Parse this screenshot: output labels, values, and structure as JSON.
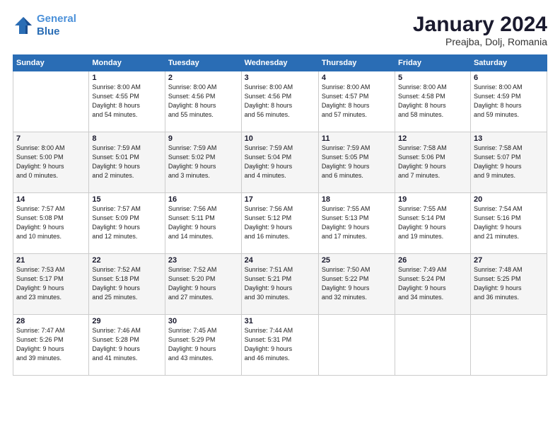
{
  "header": {
    "logo_line1": "General",
    "logo_line2": "Blue",
    "month": "January 2024",
    "location": "Preajba, Dolj, Romania"
  },
  "days_of_week": [
    "Sunday",
    "Monday",
    "Tuesday",
    "Wednesday",
    "Thursday",
    "Friday",
    "Saturday"
  ],
  "weeks": [
    [
      {
        "day": "",
        "info": ""
      },
      {
        "day": "1",
        "info": "Sunrise: 8:00 AM\nSunset: 4:55 PM\nDaylight: 8 hours\nand 54 minutes."
      },
      {
        "day": "2",
        "info": "Sunrise: 8:00 AM\nSunset: 4:56 PM\nDaylight: 8 hours\nand 55 minutes."
      },
      {
        "day": "3",
        "info": "Sunrise: 8:00 AM\nSunset: 4:56 PM\nDaylight: 8 hours\nand 56 minutes."
      },
      {
        "day": "4",
        "info": "Sunrise: 8:00 AM\nSunset: 4:57 PM\nDaylight: 8 hours\nand 57 minutes."
      },
      {
        "day": "5",
        "info": "Sunrise: 8:00 AM\nSunset: 4:58 PM\nDaylight: 8 hours\nand 58 minutes."
      },
      {
        "day": "6",
        "info": "Sunrise: 8:00 AM\nSunset: 4:59 PM\nDaylight: 8 hours\nand 59 minutes."
      }
    ],
    [
      {
        "day": "7",
        "info": "Sunrise: 8:00 AM\nSunset: 5:00 PM\nDaylight: 9 hours\nand 0 minutes."
      },
      {
        "day": "8",
        "info": "Sunrise: 7:59 AM\nSunset: 5:01 PM\nDaylight: 9 hours\nand 2 minutes."
      },
      {
        "day": "9",
        "info": "Sunrise: 7:59 AM\nSunset: 5:02 PM\nDaylight: 9 hours\nand 3 minutes."
      },
      {
        "day": "10",
        "info": "Sunrise: 7:59 AM\nSunset: 5:04 PM\nDaylight: 9 hours\nand 4 minutes."
      },
      {
        "day": "11",
        "info": "Sunrise: 7:59 AM\nSunset: 5:05 PM\nDaylight: 9 hours\nand 6 minutes."
      },
      {
        "day": "12",
        "info": "Sunrise: 7:58 AM\nSunset: 5:06 PM\nDaylight: 9 hours\nand 7 minutes."
      },
      {
        "day": "13",
        "info": "Sunrise: 7:58 AM\nSunset: 5:07 PM\nDaylight: 9 hours\nand 9 minutes."
      }
    ],
    [
      {
        "day": "14",
        "info": "Sunrise: 7:57 AM\nSunset: 5:08 PM\nDaylight: 9 hours\nand 10 minutes."
      },
      {
        "day": "15",
        "info": "Sunrise: 7:57 AM\nSunset: 5:09 PM\nDaylight: 9 hours\nand 12 minutes."
      },
      {
        "day": "16",
        "info": "Sunrise: 7:56 AM\nSunset: 5:11 PM\nDaylight: 9 hours\nand 14 minutes."
      },
      {
        "day": "17",
        "info": "Sunrise: 7:56 AM\nSunset: 5:12 PM\nDaylight: 9 hours\nand 16 minutes."
      },
      {
        "day": "18",
        "info": "Sunrise: 7:55 AM\nSunset: 5:13 PM\nDaylight: 9 hours\nand 17 minutes."
      },
      {
        "day": "19",
        "info": "Sunrise: 7:55 AM\nSunset: 5:14 PM\nDaylight: 9 hours\nand 19 minutes."
      },
      {
        "day": "20",
        "info": "Sunrise: 7:54 AM\nSunset: 5:16 PM\nDaylight: 9 hours\nand 21 minutes."
      }
    ],
    [
      {
        "day": "21",
        "info": "Sunrise: 7:53 AM\nSunset: 5:17 PM\nDaylight: 9 hours\nand 23 minutes."
      },
      {
        "day": "22",
        "info": "Sunrise: 7:52 AM\nSunset: 5:18 PM\nDaylight: 9 hours\nand 25 minutes."
      },
      {
        "day": "23",
        "info": "Sunrise: 7:52 AM\nSunset: 5:20 PM\nDaylight: 9 hours\nand 27 minutes."
      },
      {
        "day": "24",
        "info": "Sunrise: 7:51 AM\nSunset: 5:21 PM\nDaylight: 9 hours\nand 30 minutes."
      },
      {
        "day": "25",
        "info": "Sunrise: 7:50 AM\nSunset: 5:22 PM\nDaylight: 9 hours\nand 32 minutes."
      },
      {
        "day": "26",
        "info": "Sunrise: 7:49 AM\nSunset: 5:24 PM\nDaylight: 9 hours\nand 34 minutes."
      },
      {
        "day": "27",
        "info": "Sunrise: 7:48 AM\nSunset: 5:25 PM\nDaylight: 9 hours\nand 36 minutes."
      }
    ],
    [
      {
        "day": "28",
        "info": "Sunrise: 7:47 AM\nSunset: 5:26 PM\nDaylight: 9 hours\nand 39 minutes."
      },
      {
        "day": "29",
        "info": "Sunrise: 7:46 AM\nSunset: 5:28 PM\nDaylight: 9 hours\nand 41 minutes."
      },
      {
        "day": "30",
        "info": "Sunrise: 7:45 AM\nSunset: 5:29 PM\nDaylight: 9 hours\nand 43 minutes."
      },
      {
        "day": "31",
        "info": "Sunrise: 7:44 AM\nSunset: 5:31 PM\nDaylight: 9 hours\nand 46 minutes."
      },
      {
        "day": "",
        "info": ""
      },
      {
        "day": "",
        "info": ""
      },
      {
        "day": "",
        "info": ""
      }
    ]
  ]
}
